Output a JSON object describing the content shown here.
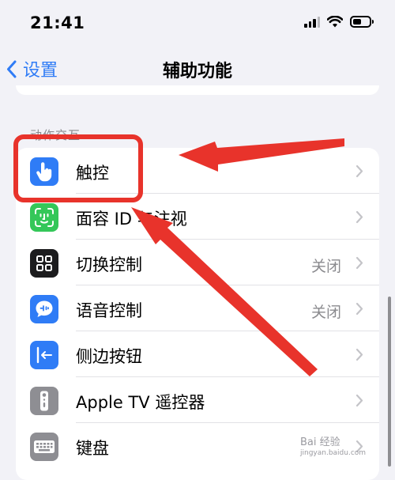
{
  "status_bar": {
    "time": "21:41"
  },
  "nav": {
    "back_label": "设置",
    "title": "辅助功能"
  },
  "section_header": "动作交互",
  "rows": [
    {
      "label": "触控",
      "value": "",
      "icon": "touch-hand-icon",
      "icon_color": "#2f7cf6"
    },
    {
      "label": "面容 ID 与注视",
      "value": "",
      "icon": "face-id-icon",
      "icon_color": "#34c759"
    },
    {
      "label": "切换控制",
      "value": "关闭",
      "icon": "switch-control-grid-icon",
      "icon_color": "#1c1c1e"
    },
    {
      "label": "语音控制",
      "value": "关闭",
      "icon": "voice-control-icon",
      "icon_color": "#2f7cf6"
    },
    {
      "label": "侧边按钮",
      "value": "",
      "icon": "side-button-icon",
      "icon_color": "#2f7cf6"
    },
    {
      "label": "Apple TV 遥控器",
      "value": "",
      "icon": "tv-remote-icon",
      "icon_color": "#8e8e93"
    },
    {
      "label": "键盘",
      "value": "",
      "icon": "keyboard-icon",
      "icon_color": "#8e8e93"
    }
  ],
  "watermark": {
    "text": "Bai 经验",
    "sub": "jingyan.baidu.com"
  },
  "colors": {
    "accent": "#2f7cf6",
    "annotation_red": "#e8332b"
  }
}
